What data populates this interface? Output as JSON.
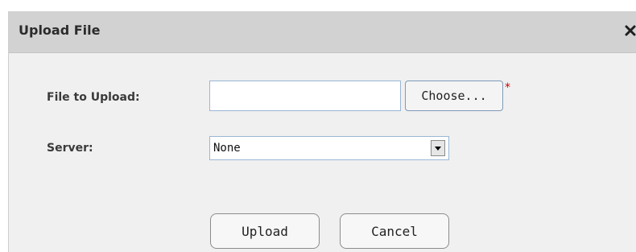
{
  "dialog": {
    "title": "Upload File",
    "close_icon": "close-icon"
  },
  "form": {
    "file_label": "File to Upload:",
    "file_value": "",
    "choose_label": "Choose...",
    "required_mark": "*",
    "server_label": "Server:",
    "server_selected": "None"
  },
  "actions": {
    "upload_label": "Upload",
    "cancel_label": "Cancel"
  },
  "colors": {
    "titlebar": "#d2d2d2",
    "dialog_body": "#f0f0f0",
    "required": "#d00000",
    "input_border": "#9ab6d4"
  }
}
